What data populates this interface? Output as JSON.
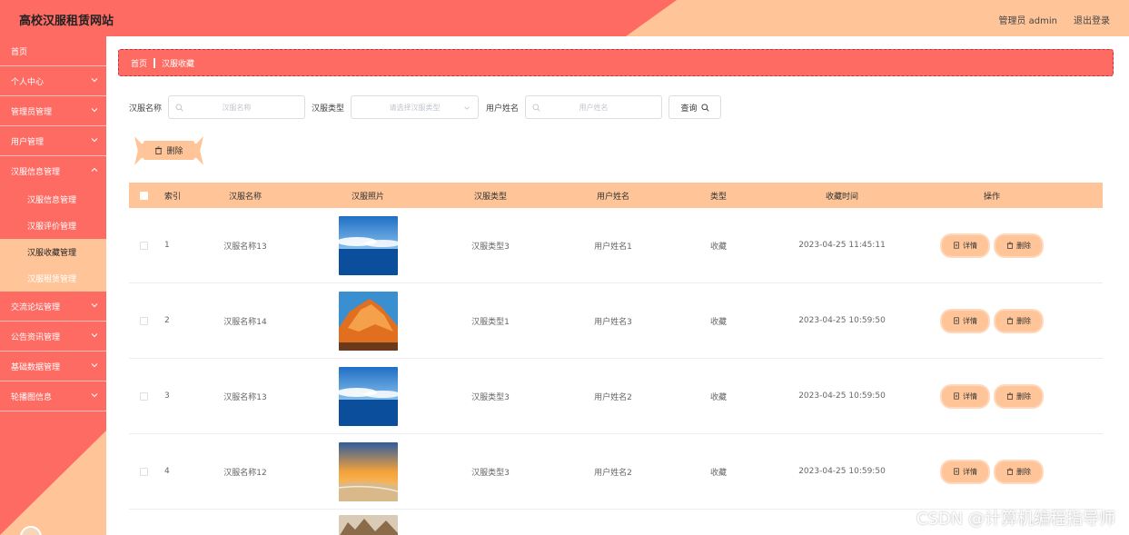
{
  "header": {
    "title": "高校汉服租赁网站",
    "user": "管理员 admin",
    "logout": "退出登录"
  },
  "sidebar": {
    "items": [
      {
        "label": "首页",
        "chevron": false
      },
      {
        "label": "个人中心",
        "chevron": true
      },
      {
        "label": "管理员管理",
        "chevron": true
      },
      {
        "label": "用户管理",
        "chevron": true
      },
      {
        "label": "汉服信息管理",
        "chevron": true,
        "open": true,
        "children": [
          "汉服信息管理",
          "汉服评价管理",
          "汉服收藏管理",
          "汉服租赁管理"
        ]
      },
      {
        "label": "交流论坛管理",
        "chevron": true
      },
      {
        "label": "公告资讯管理",
        "chevron": true
      },
      {
        "label": "基础数据管理",
        "chevron": true
      },
      {
        "label": "轮播图信息",
        "chevron": true
      }
    ]
  },
  "breadcrumb": {
    "home": "首页",
    "current": "汉服收藏"
  },
  "search": {
    "name_label": "汉服名称",
    "name_placeholder": "汉服名称",
    "type_label": "汉服类型",
    "type_placeholder": "请选择汉服类型",
    "user_label": "用户姓名",
    "user_placeholder": "用户姓名",
    "query_label": "查询"
  },
  "actions": {
    "delete_label": "删除"
  },
  "table": {
    "headers": [
      "索引",
      "汉服名称",
      "汉服照片",
      "汉服类型",
      "用户姓名",
      "类型",
      "收藏时间",
      "操作"
    ],
    "rows": [
      {
        "index": "1",
        "name": "汉服名称13",
        "photo": "sky-sea",
        "type": "汉服类型3",
        "user": "用户姓名1",
        "kind": "收藏",
        "time": "2023-04-25 11:45:11"
      },
      {
        "index": "2",
        "name": "汉服名称14",
        "photo": "orange-rock",
        "type": "汉服类型1",
        "user": "用户姓名3",
        "kind": "收藏",
        "time": "2023-04-25 10:59:50"
      },
      {
        "index": "3",
        "name": "汉服名称13",
        "photo": "sky-sea",
        "type": "汉服类型3",
        "user": "用户姓名2",
        "kind": "收藏",
        "time": "2023-04-25 10:59:50"
      },
      {
        "index": "4",
        "name": "汉服名称12",
        "photo": "sunset-beach",
        "type": "汉服类型3",
        "user": "用户姓名2",
        "kind": "收藏",
        "time": "2023-04-25 10:59:50"
      }
    ],
    "detail_label": "详情",
    "delete_label": "删除"
  },
  "watermark": "CSDN @计算机编程指导师",
  "colors": {
    "primary": "#fe6b63",
    "accent": "#ffc599"
  }
}
